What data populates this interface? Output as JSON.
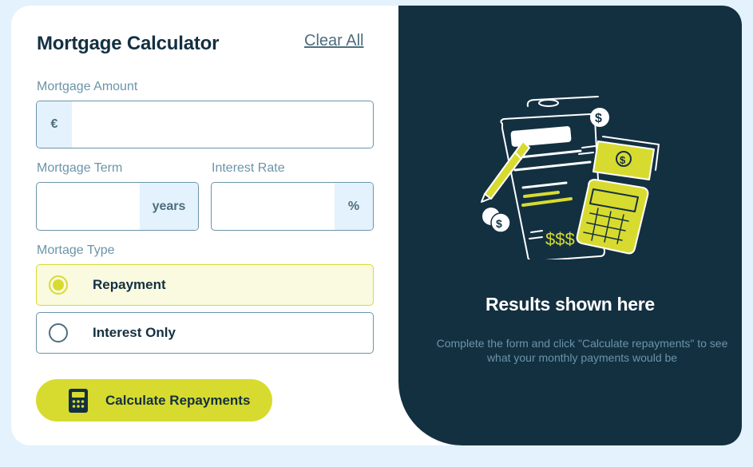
{
  "form": {
    "title": "Mortgage Calculator",
    "clear_all": "Clear All",
    "amount": {
      "label": "Mortgage Amount",
      "prefix": "€",
      "value": ""
    },
    "term": {
      "label": "Mortgage Term",
      "suffix": "years",
      "value": ""
    },
    "rate": {
      "label": "Interest Rate",
      "suffix": "%",
      "value": ""
    },
    "type": {
      "label": "Mortage Type",
      "options": [
        {
          "label": "Repayment",
          "selected": true
        },
        {
          "label": "Interest Only",
          "selected": false
        }
      ]
    },
    "calculate_label": "Calculate Repayments"
  },
  "results": {
    "title": "Results shown here",
    "description": "Complete the form and click \"Calculate repayments\" to see what your monthly payments would be"
  },
  "colors": {
    "lime": "#d8db2f",
    "dark": "#133041",
    "slate": "#4e6e7e",
    "light_blue": "#e3f2fc"
  },
  "icons": [
    "calculator-icon",
    "empty-results-illustration"
  ]
}
